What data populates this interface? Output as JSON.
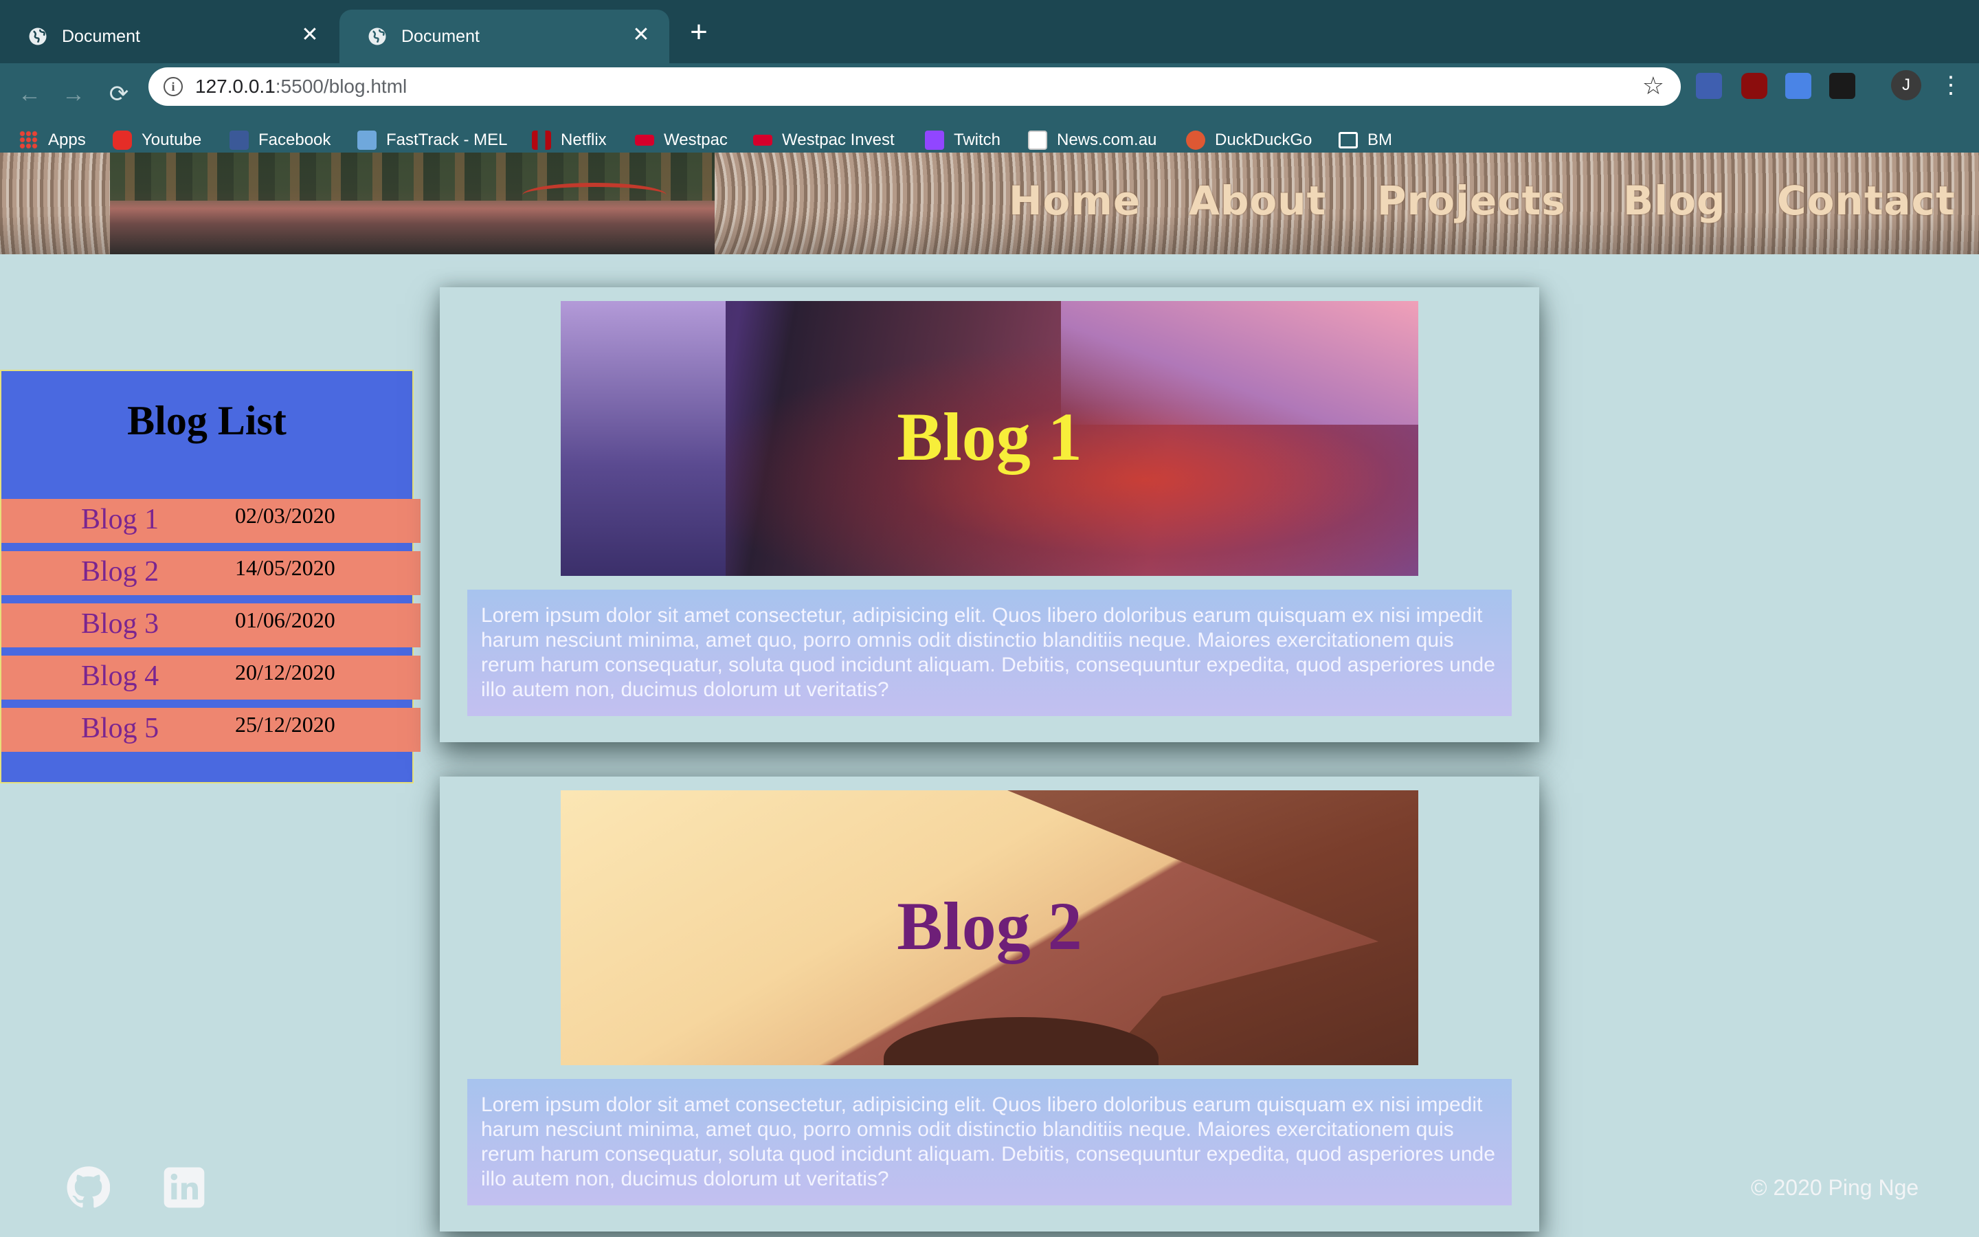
{
  "browser": {
    "tabs": [
      {
        "title": "Document",
        "active": false
      },
      {
        "title": "Document",
        "active": true
      }
    ],
    "new_tab_label": "+",
    "close_glyph": "✕",
    "url_host": "127.0.0.1",
    "url_rest": ":5500/blog.html",
    "profile_initial": "J",
    "bookmarks": [
      {
        "label": "Apps",
        "icon": "apps-grid-icon"
      },
      {
        "label": "Youtube",
        "icon": "youtube-icon"
      },
      {
        "label": "Facebook",
        "icon": "facebook-icon"
      },
      {
        "label": "FastTrack - MEL",
        "icon": "fasttrack-icon"
      },
      {
        "label": "Netflix",
        "icon": "netflix-icon"
      },
      {
        "label": "Westpac",
        "icon": "westpac-icon"
      },
      {
        "label": "Westpac Invest",
        "icon": "westpac-icon"
      },
      {
        "label": "Twitch",
        "icon": "twitch-icon"
      },
      {
        "label": "News.com.au",
        "icon": "news-icon"
      },
      {
        "label": "DuckDuckGo",
        "icon": "duckduckgo-icon"
      },
      {
        "label": "BM",
        "icon": "folder-icon"
      }
    ]
  },
  "site": {
    "nav": [
      "Home",
      "About",
      "Projects",
      "Blog",
      "Contact"
    ],
    "sidebar": {
      "title": "Blog List",
      "items": [
        {
          "name": "Blog 1",
          "date": "02/03/2020"
        },
        {
          "name": "Blog 2",
          "date": "14/05/2020"
        },
        {
          "name": "Blog 3",
          "date": "01/06/2020"
        },
        {
          "name": "Blog 4",
          "date": "20/12/2020"
        },
        {
          "name": "Blog 5",
          "date": "25/12/2020"
        }
      ]
    },
    "posts": [
      {
        "title": "Blog 1",
        "title_color": "#f7ee3a",
        "text": "Lorem ipsum dolor sit amet consectetur, adipisicing elit. Quos libero doloribus earum quisquam ex nisi impedit harum nesciunt minima, amet quo, porro omnis odit distinctio blanditiis neque. Maiores exercitationem quis rerum harum consequatur, soluta quod incidunt aliquam. Debitis, consequuntur expedita, quod asperiores unde illo autem non, ducimus dolorum ut veritatis?"
      },
      {
        "title": "Blog 2",
        "title_color": "#6e1f78",
        "text": "Lorem ipsum dolor sit amet consectetur, adipisicing elit. Quos libero doloribus earum quisquam ex nisi impedit harum nesciunt minima, amet quo, porro omnis odit distinctio blanditiis neque. Maiores exercitationem quis rerum harum consequatur, soluta quod incidunt aliquam. Debitis, consequuntur expedita, quod asperiores unde illo autem non, ducimus dolorum ut veritatis?"
      }
    ],
    "footer": {
      "social": [
        "github-icon",
        "linkedin-icon"
      ],
      "copyright": "© 2020 Ping Nge"
    }
  }
}
